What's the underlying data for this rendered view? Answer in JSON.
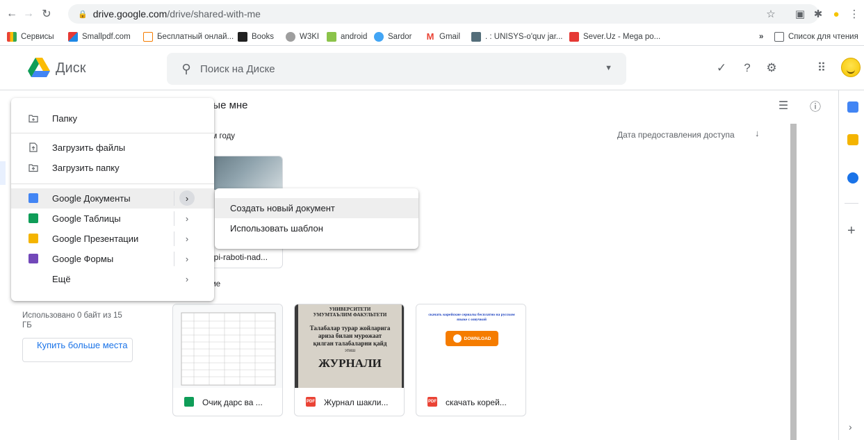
{
  "browser": {
    "url_host": "drive.google.com",
    "url_path": "/drive/shared-with-me",
    "bookmarks": [
      "Сервисы",
      "Smallpdf.com",
      "Бесплатный онлай...",
      "Books",
      "W3KI",
      "android",
      "Sardor",
      "Gmail",
      ". : UNISYS-o'quv jar...",
      "Sever.Uz - Mega po..."
    ],
    "more": "»",
    "reading_list": "Список для чтения"
  },
  "header": {
    "title": "Диск",
    "search_placeholder": "Поиск на Диске"
  },
  "main": {
    "title": "ные мне",
    "section_year": "ом году",
    "section_earlier": "ние",
    "sort_label": "Дата предоставления доступа",
    "folder_card_name": "api-raboti-nad...",
    "cards": [
      {
        "name": "Очиқ дарс ва ...",
        "type": "sheet"
      },
      {
        "name": "Журнал шакли...",
        "type": "pdf"
      },
      {
        "name": "скачать корей...",
        "type": "pdf"
      }
    ],
    "pdf_badge": "PDF",
    "thumb2_lines": [
      "УНИВЕРСИТЕТИ",
      "УМУМТАЪЛИМ ФАКУЛЬТЕТИ",
      "Талабалар турар жойларига",
      "ариза билан мурожаат",
      "қилган талабаларни қайд",
      "этиш",
      "ЖУРНАЛИ"
    ],
    "thumb3_text": "скачать корейские сериалы бесплатно на русском языке с озвучкой",
    "thumb3_button": "DOWNLOAD"
  },
  "sidebar": {
    "storage_text": "Использовано 0 байт из 15 ГБ",
    "buy_label": "Купить больше места"
  },
  "new_menu": {
    "items": [
      {
        "label": "Папку"
      },
      {
        "label": "Загрузить файлы"
      },
      {
        "label": "Загрузить папку"
      },
      {
        "label": "Google Документы"
      },
      {
        "label": "Google Таблицы"
      },
      {
        "label": "Google Презентации"
      },
      {
        "label": "Google Формы"
      },
      {
        "label": "Ещё"
      }
    ]
  },
  "submenu": {
    "items": [
      "Создать новый документ",
      "Использовать шаблон"
    ]
  },
  "colors": {
    "blue": "#4285f4",
    "green": "#0f9d58",
    "yellow": "#f4b400",
    "purple": "#7248b9",
    "link": "#1a73e8"
  }
}
